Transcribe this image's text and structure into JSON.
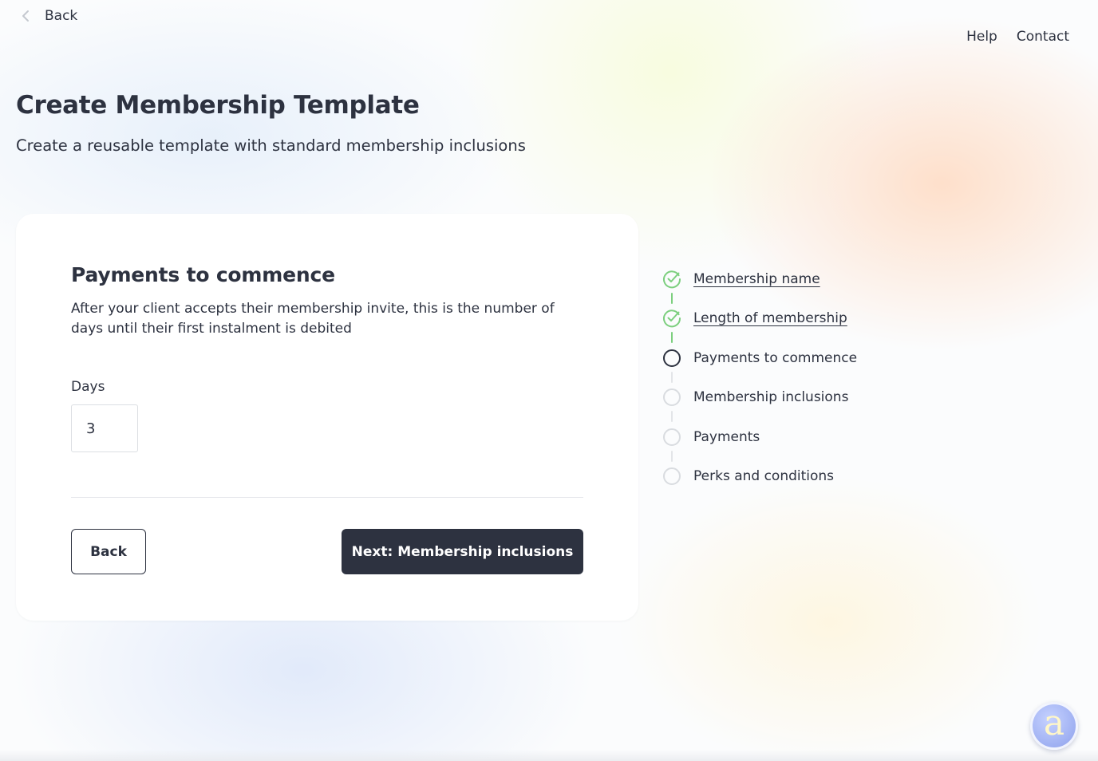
{
  "top_bar": {
    "back_label": "Back",
    "nav": [
      {
        "label": "Help"
      },
      {
        "label": "Contact"
      }
    ]
  },
  "header": {
    "title": "Create Membership Template",
    "subtitle": "Create a reusable template with standard membership inclusions"
  },
  "form": {
    "heading": "Payments to commence",
    "description": "After your client accepts their membership invite, this is the number of days until their first instalment is debited",
    "days_label": "Days",
    "days_value": "3",
    "back_button": "Back",
    "next_button": "Next: Membership inclusions"
  },
  "steps": [
    {
      "label": "Membership name",
      "status": "completed"
    },
    {
      "label": "Length of membership",
      "status": "completed"
    },
    {
      "label": "Payments to commence",
      "status": "current"
    },
    {
      "label": "Membership inclusions",
      "status": "upcoming"
    },
    {
      "label": "Payments",
      "status": "upcoming"
    },
    {
      "label": "Perks and conditions",
      "status": "upcoming"
    }
  ],
  "assistant": {
    "icon": "assistant-icon",
    "glyph": "a"
  },
  "colors": {
    "text": "#2d3240",
    "primary_button": "#2d3240",
    "step_complete": "#7dcf7f",
    "step_upcoming": "#d9dce0",
    "card": "#ffffff"
  }
}
